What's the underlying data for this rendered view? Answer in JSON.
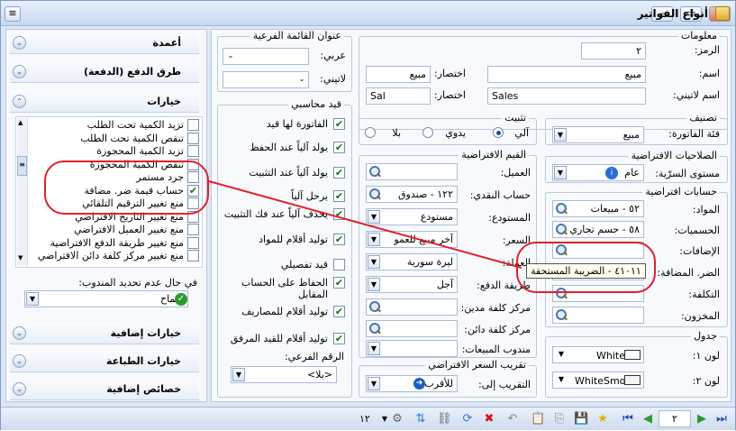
{
  "window": {
    "title": "أنواع الفواتير"
  },
  "info_group": {
    "title": "معلومات",
    "code_label": "الرمز:",
    "code_value": "٢",
    "name_label": "اسم:",
    "name_value": "مبيع",
    "abbr_label": "اختصار:",
    "abbr_value": "مبيع",
    "latin_name_label": "اسم لاتيني:",
    "latin_name_value": "Sales",
    "latin_abbr_label": "اختصار:",
    "latin_abbr_value": "Sal"
  },
  "submenu_group": {
    "title": "عنوان القائمة الفرعية",
    "arabic_label": "عربي:",
    "arabic_value": "",
    "latin_label": "لاتيني:",
    "latin_value": ""
  },
  "classification": {
    "title": "تصنيف",
    "category_label": "فئة الفاتورة:",
    "category_value": "مبيع"
  },
  "default_permissions": {
    "title": "الصلاحيات الافتراضية",
    "level_label": "مستوى السرّية:",
    "level_value": "عام"
  },
  "default_accounts": {
    "title": "حسابات افتراضية",
    "materials_label": "المواد:",
    "materials_value": "٥٢ - مبيعات",
    "discounts_label": "الحسميات:",
    "discounts_value": "٥٨ - حسم تجاري",
    "additions_label": "الإضافات:",
    "additions_value": "",
    "vat_label": "الضر. المضافة:",
    "vat_value": "٤١٠١١ - الضريبة المستحقة",
    "cost_label": "التكلفة:",
    "cost_value": "",
    "stock_label": "المخزون:",
    "stock_value": ""
  },
  "table": {
    "title": "جدول",
    "color1_label": "لون ١:",
    "color1_value": "White",
    "color2_label": "لون ٢:",
    "color2_value": "WhiteSmo"
  },
  "stabilize": {
    "title": "تثبيت",
    "options": [
      "آلي",
      "يدوي",
      "بلا"
    ],
    "selected": "آلي"
  },
  "defaults": {
    "title": "القيم الافتراضية",
    "customer_label": "العميل:",
    "customer_value": "",
    "cash_label": "حساب النقدي:",
    "cash_value": "١٢٢ - صندوق",
    "warehouse_label": "المستودع:",
    "warehouse_value": "مستودع",
    "price_label": "السعر:",
    "price_value": "آخر مبيع للعمو",
    "currency_label": "العملة:",
    "currency_value": "ليرة سورية",
    "payment_label": "طريقة الدفع:",
    "payment_value": "آجل",
    "debit_cc_label": "مركز كلفة مدين:",
    "debit_cc_value": "",
    "credit_cc_label": "مركز كلفة دائن:",
    "credit_cc_value": "",
    "rep_label": "مندوب المبيعات:",
    "rep_value": ""
  },
  "rounding": {
    "title": "تقريب السعر الافتراضي",
    "label": "التقريب إلى:",
    "value": "للأقرب"
  },
  "accounting": {
    "title": "قيد محاسبي",
    "items": [
      {
        "label": "الفاتورة لها قيد",
        "checked": true
      },
      {
        "label": "يولد آلياً عند الحفظ",
        "checked": true
      },
      {
        "label": "يولد آلياً عند التثبيت",
        "checked": true
      },
      {
        "label": "يرحل آلياً",
        "checked": true
      },
      {
        "label": "يحذف آلياً عند فك التثبيت",
        "checked": true
      },
      {
        "label": "توليد أقلام للمواد",
        "checked": true
      },
      {
        "label": "قيد تفصيلي",
        "checked": false
      },
      {
        "label": "الحفاظ على الحساب المقابل",
        "checked": true
      },
      {
        "label": "توليد أقلام للمصاريف",
        "checked": true
      },
      {
        "label": "توليد أقلام للقيد المرفق",
        "checked": true
      }
    ],
    "sub_number_label": "الرقم الفرعي:",
    "sub_number_value": "<بلا>"
  },
  "left_sections": {
    "columns": "أعمدة",
    "payment_methods": "طرق الدفع (الدفعة)",
    "options": "خيارات",
    "extra_options": "خيارات إضافية",
    "print_options": "خيارات الطباعة",
    "extra_properties": "خصائص إضافية"
  },
  "options_list": [
    {
      "label": "تزيد الكمية تحت الطلب",
      "checked": false
    },
    {
      "label": "تنقص الكمية تحت الطلب",
      "checked": false
    },
    {
      "label": "تزيد الكمية المحجوزة",
      "checked": false
    },
    {
      "label": "تنقص الكمية المحجوزة",
      "checked": false
    },
    {
      "label": "جرد مستمر",
      "checked": false
    },
    {
      "label": "حساب قيمة ضر. مضافة",
      "checked": true
    },
    {
      "label": "منع تغيير الترقيم التلقائي",
      "checked": false
    },
    {
      "label": "منع تغيير التاريخ الافتراضي",
      "checked": false
    },
    {
      "label": "منع تغيير العميل الافتراضي",
      "checked": false
    },
    {
      "label": "منع تغيير طريقة الدفع الافتراضية",
      "checked": false
    },
    {
      "label": "منع تغيير مركز كلفة دائن الافتراضي",
      "checked": false
    }
  ],
  "rep_section": {
    "label": "في حال عدم تحديد المندوب:",
    "value": "سماح"
  },
  "status": {
    "page_current": "٢",
    "record_count": "١٢"
  }
}
